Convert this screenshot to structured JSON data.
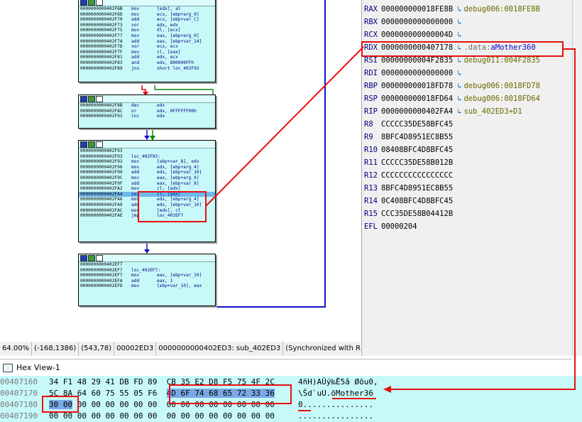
{
  "graph": {
    "node1": {
      "rows": [
        {
          "addr": "0000000000402F6B",
          "mn": "mov",
          "op": "[edx], al"
        },
        {
          "addr": "0000000000402F6D",
          "mn": "mov",
          "op": "ecx, [ebp+arg_0]"
        },
        {
          "addr": "0000000000402F70",
          "mn": "add",
          "op": "ecx, [ebp+var_C]"
        },
        {
          "addr": "0000000000402F73",
          "mn": "xor",
          "op": "edx, edx"
        },
        {
          "addr": "0000000000402F75",
          "mn": "mov",
          "op": "dl, [ecx]"
        },
        {
          "addr": "0000000000402F77",
          "mn": "mov",
          "op": "eax, [ebp+arg_0]"
        },
        {
          "addr": "0000000000402F7A",
          "mn": "add",
          "op": "eax, [ebp+var_14]"
        },
        {
          "addr": "0000000000402F7D",
          "mn": "xor",
          "op": "ecx, ecx"
        },
        {
          "addr": "0000000000402F7F",
          "mn": "mov",
          "op": "cl, [eax]"
        },
        {
          "addr": "0000000000402F81",
          "mn": "add",
          "op": "edx, ecx"
        },
        {
          "addr": "0000000000402F83",
          "mn": "and",
          "op": "edx, 800000FFh"
        },
        {
          "addr": "0000000000402F89",
          "mn": "jns",
          "op": "short loc_402F93"
        }
      ]
    },
    "node2": {
      "rows": [
        {
          "addr": "0000000000402F8B",
          "mn": "dec",
          "op": "edx"
        },
        {
          "addr": "0000000000402F8C",
          "mn": "or",
          "op": "edx, 0FFFFFF00h"
        },
        {
          "addr": "0000000000402F92",
          "mn": "inc",
          "op": "edx"
        }
      ]
    },
    "node3": {
      "rows": [
        {
          "addr": "0000000000402F93",
          "mn": "",
          "op": ""
        },
        {
          "addr": "0000000000402F93",
          "mn": "loc_402F93:",
          "op": ""
        },
        {
          "addr": "0000000000402F93",
          "mn": "mov",
          "op": "[ebp+var_8], edx"
        },
        {
          "addr": "0000000000402F96",
          "mn": "mov",
          "op": "edx, [ebp+arg_4]"
        },
        {
          "addr": "0000000000402F99",
          "mn": "add",
          "op": "edx, [ebp+var_10]"
        },
        {
          "addr": "0000000000402F9C",
          "mn": "mov",
          "op": "eax, [ebp+arg_0]"
        },
        {
          "addr": "0000000000402F9F",
          "mn": "add",
          "op": "eax, [ebp+var_8]"
        },
        {
          "addr": "0000000000402FA2",
          "mn": "mov",
          "op": "cl, [edx]"
        },
        {
          "addr": "0000000000402FA4",
          "mn": "xor",
          "op": "cl, [eax]"
        },
        {
          "addr": "0000000000402FA6",
          "mn": "mov",
          "op": "edx, [ebp+arg_4]"
        },
        {
          "addr": "0000000000402FA9",
          "mn": "add",
          "op": "edx, [ebp+var_10]"
        },
        {
          "addr": "0000000000402FAC",
          "mn": "mov",
          "op": "[edx], cl"
        },
        {
          "addr": "0000000000402FAE",
          "mn": "jmp",
          "op": "loc_402EF7"
        }
      ]
    },
    "node4": {
      "rows": [
        {
          "addr": "0000000000402EF7",
          "mn": "",
          "op": ""
        },
        {
          "addr": "0000000000402EF7",
          "mn": "loc_402EF7:",
          "op": ""
        },
        {
          "addr": "0000000000402EF7",
          "mn": "mov",
          "op": "eax, [ebp+var_10]"
        },
        {
          "addr": "0000000000402EFA",
          "mn": "add",
          "op": "eax, 1"
        },
        {
          "addr": "0000000000402EFD",
          "mn": "mov",
          "op": "[ebp+var_10], eax"
        }
      ]
    }
  },
  "status": {
    "zoom": "64.00%",
    "coords1": "(-168,1386)",
    "coords2": "(543,78)",
    "offset": "00002ED3",
    "location": "0000000000402ED3: sub_402ED3",
    "sync": "(Synchronized with RIP)"
  },
  "registers": [
    {
      "name": "RAX",
      "value": "000000000018FE8B",
      "target": "debug006:0018FE8B"
    },
    {
      "name": "RBX",
      "value": "0000000000000000",
      "target": ""
    },
    {
      "name": "RCX",
      "value": "000000000000004D",
      "target": ""
    },
    {
      "name": "RDX",
      "value": "0000000000407178",
      "target_seg": ".data:",
      "target_name": "aMother360"
    },
    {
      "name": "RSI",
      "value": "00000000004F2835",
      "target": "debug011:004F2835"
    },
    {
      "name": "RDI",
      "value": "0000000000000000",
      "target": ""
    },
    {
      "name": "RBP",
      "value": "000000000018FD78",
      "target": "debug006:0018FD78"
    },
    {
      "name": "RSP",
      "value": "000000000018FD64",
      "target": "debug006:0018FD64"
    },
    {
      "name": "RIP",
      "value": "0000000000402FA4",
      "target": "sub_402ED3+D1"
    },
    {
      "name": "R8",
      "value": "CCCCC35DE58BFC45"
    },
    {
      "name": "R9",
      "value": "8BFC4D8951EC8B55"
    },
    {
      "name": "R10",
      "value": "08408BFC4D8BFC45"
    },
    {
      "name": "R11",
      "value": "CCCCC35DE58B012B"
    },
    {
      "name": "R12",
      "value": "CCCCCCCCCCCCCCCC"
    },
    {
      "name": "R13",
      "value": "8BFC4D8951EC8B55"
    },
    {
      "name": "R14",
      "value": "0C408BFC4D8BFC45"
    },
    {
      "name": "R15",
      "value": "CCC35DE58B04412B"
    },
    {
      "name": "EFL",
      "value": "00000204"
    }
  ],
  "hex": {
    "title": "Hex View-1",
    "rows": [
      {
        "addr": "00407160",
        "bytes_a": "34 F1 48 29 41 DB FD 89",
        "bytes_b": "CB 35 E2 D8 F5 75 4F 2C",
        "ascii": "4ñH)AÛý‰Ë5â Øõu0,"
      },
      {
        "addr": "00407170",
        "bytes_a": "5C 8A 64 60 75 55 05 F6",
        "bytes_b": "4D 6F 74 68 65 72 33 36",
        "ascii": "\\Šd`uU.öMother36"
      },
      {
        "addr": "00407180",
        "bytes_a": "30 00 00 00 00 00 00 00",
        "bytes_b": "00 00 00 00 00 00 00 00",
        "ascii": "0..............."
      },
      {
        "addr": "00407190",
        "bytes_a": "00 00 00 00 00 00 00 00",
        "bytes_b": "00 00 00 00 00 00 00 00",
        "ascii": "................"
      }
    ]
  }
}
